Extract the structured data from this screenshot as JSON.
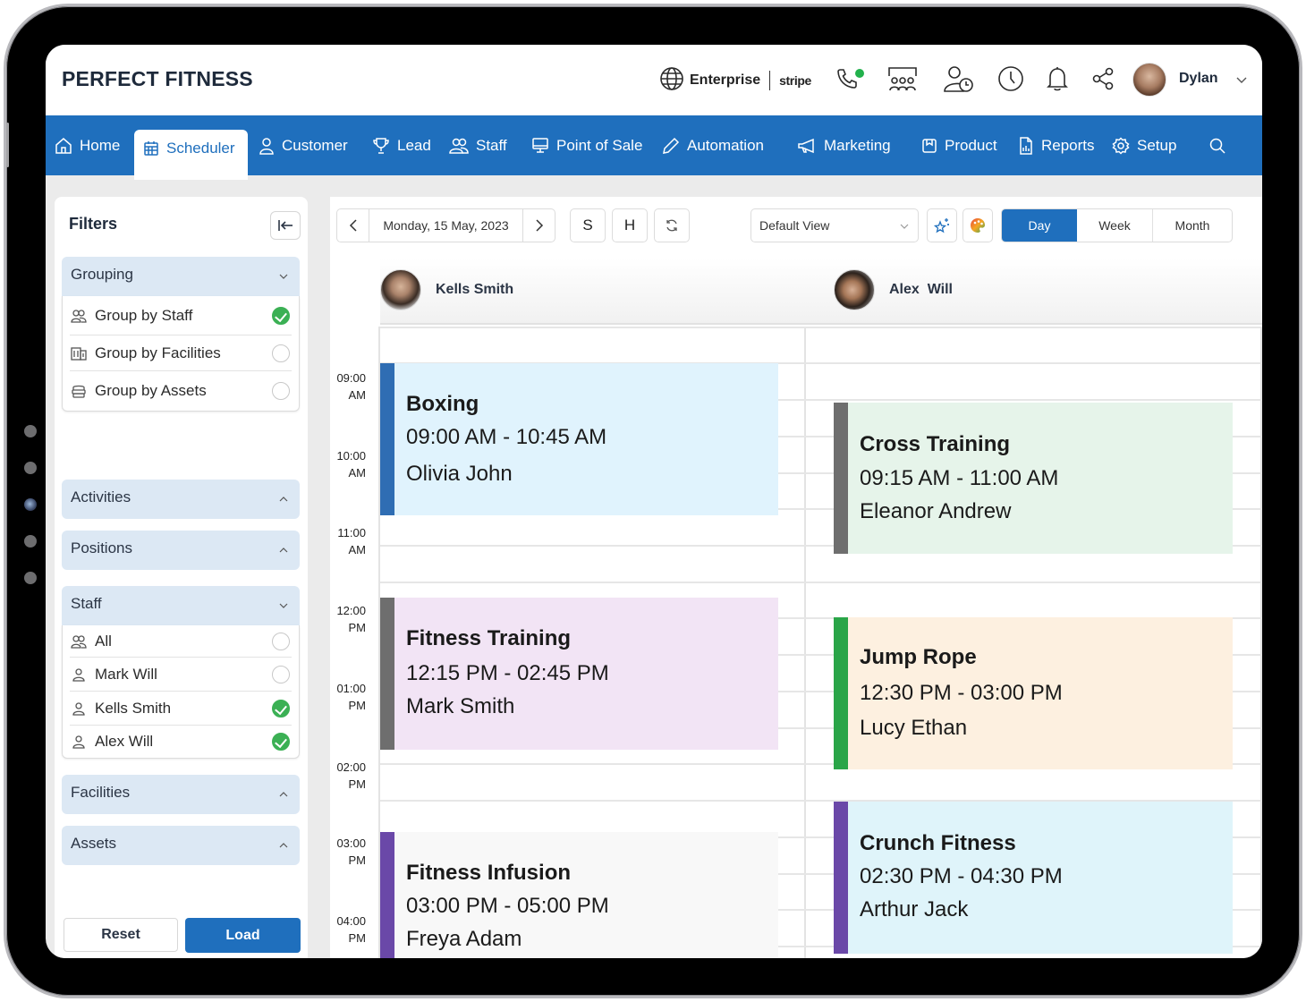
{
  "app": {
    "brand": "PERFECT FITNESS",
    "plan": "Enterprise",
    "payment_provider": "stripe",
    "user_name": "Dylan",
    "header_icons": [
      "globe-icon",
      "phone-icon",
      "presence-dot",
      "group-meeting-icon",
      "user-clock-icon",
      "clock-icon",
      "bell-icon",
      "share-icon",
      "avatar",
      "chevron-down-icon"
    ]
  },
  "nav": {
    "items": [
      {
        "label": "Home",
        "icon": "home-icon"
      },
      {
        "label": "Scheduler",
        "icon": "calendar-icon",
        "active": true
      },
      {
        "label": "Customer",
        "icon": "user-icon"
      },
      {
        "label": "Lead",
        "icon": "trophy-icon"
      },
      {
        "label": "Staff",
        "icon": "users-icon"
      },
      {
        "label": "Point of Sale",
        "icon": "monitor-icon"
      },
      {
        "label": "Automation",
        "icon": "pencil-icon"
      },
      {
        "label": "Marketing",
        "icon": "megaphone-icon"
      },
      {
        "label": "Product",
        "icon": "box-icon"
      },
      {
        "label": "Reports",
        "icon": "report-icon"
      },
      {
        "label": "Setup",
        "icon": "gear-icon"
      }
    ],
    "search_icon": "search-icon"
  },
  "sidebar": {
    "title": "Filters",
    "sections": {
      "grouping": {
        "title": "Grouping",
        "expanded": true,
        "options": [
          {
            "label": "Group by Staff",
            "selected": true
          },
          {
            "label": "Group by Facilities",
            "selected": false
          },
          {
            "label": "Group by Assets",
            "selected": false
          }
        ]
      },
      "activities": {
        "title": "Activities",
        "expanded": false
      },
      "positions": {
        "title": "Positions",
        "expanded": false
      },
      "staff": {
        "title": "Staff",
        "expanded": true,
        "options": [
          {
            "label": "All",
            "selected": false
          },
          {
            "label": "Mark Will",
            "selected": false
          },
          {
            "label": "Kells Smith",
            "selected": true
          },
          {
            "label": "Alex Will",
            "selected": true
          }
        ]
      },
      "facilities": {
        "title": "Facilities",
        "expanded": false
      },
      "assets": {
        "title": "Assets",
        "expanded": false
      }
    },
    "reset_label": "Reset",
    "load_label": "Load"
  },
  "toolbar": {
    "date": "Monday, 15 May, 2023",
    "s_label": "S",
    "h_label": "H",
    "view_select": "Default View",
    "modes": [
      "Day",
      "Week",
      "Month"
    ],
    "active_mode": "Day"
  },
  "scheduler": {
    "time_labels": [
      {
        "hour": "09:00",
        "ampm": "AM"
      },
      {
        "hour": "10:00",
        "ampm": "AM"
      },
      {
        "hour": "11:00",
        "ampm": "AM"
      },
      {
        "hour": "12:00",
        "ampm": "PM"
      },
      {
        "hour": "01:00",
        "ampm": "PM"
      },
      {
        "hour": "02:00",
        "ampm": "PM"
      },
      {
        "hour": "03:00",
        "ampm": "PM"
      },
      {
        "hour": "04:00",
        "ampm": "PM"
      }
    ],
    "resources": [
      {
        "name": "Kells Smith"
      },
      {
        "name": "Alex  Will"
      }
    ],
    "events": [
      {
        "resource": 0,
        "title": "Boxing",
        "time": "09:00 AM - 10:45 AM",
        "person": "Olivia John",
        "bar_color": "#2f6db3",
        "bg_color": "#e0f3fd"
      },
      {
        "resource": 0,
        "title": "Fitness Training",
        "time": "12:15 PM - 02:45 PM",
        "person": "Mark Smith",
        "bar_color": "#6e6e6e",
        "bg_color": "#f2e4f5"
      },
      {
        "resource": 0,
        "title": "Fitness Infusion",
        "time": "03:00 PM - 05:00 PM",
        "person": "Freya Adam",
        "bar_color": "#6a48a8",
        "bg_color": "#f8f8f8"
      },
      {
        "resource": 1,
        "title": "Cross Training",
        "time": "09:15 AM - 11:00 AM",
        "person": "Eleanor Andrew",
        "bar_color": "#6e6e6e",
        "bg_color": "#e6f4ea"
      },
      {
        "resource": 1,
        "title": "Jump Rope",
        "time": "12:30 PM - 03:00 PM",
        "person": "Lucy Ethan",
        "bar_color": "#2aa548",
        "bg_color": "#fdf0e0"
      },
      {
        "resource": 1,
        "title": "Crunch Fitness",
        "time": "02:30 PM - 04:30 PM",
        "person": "Arthur Jack",
        "bar_color": "#6a48a8",
        "bg_color": "#dff4fa"
      }
    ]
  },
  "colors": {
    "primary": "#1f6fbd",
    "accordion_bg": "#dce8f4",
    "check_green": "#3bb054",
    "presence_green": "#22b14c"
  }
}
